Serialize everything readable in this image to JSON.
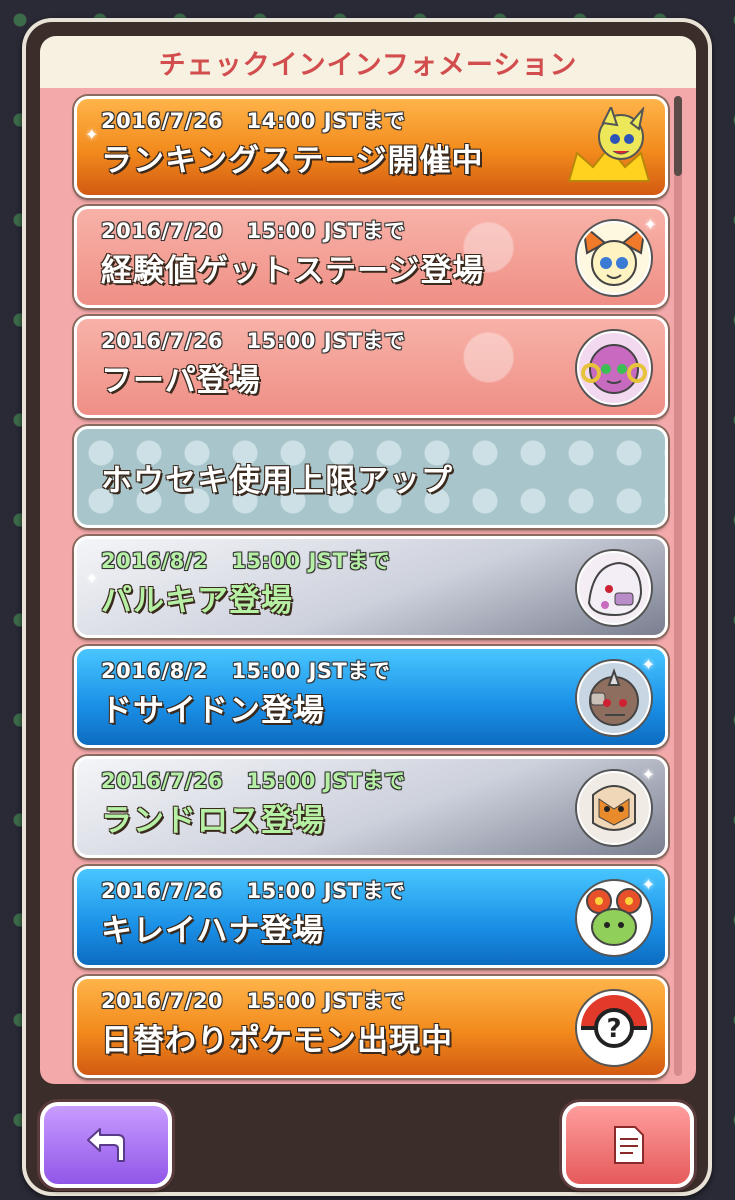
{
  "header": {
    "title": "チェックインインフォメーション"
  },
  "items": [
    {
      "date": "2016/7/26   14:00 JSTまで",
      "name": "ランキングステージ開催中",
      "style": "orange",
      "icon": "meowstic-crown-icon"
    },
    {
      "date": "2016/7/20   15:00 JSTまで",
      "name": "経験値ゲットステージ登場",
      "style": "salmon",
      "icon": "victini-icon"
    },
    {
      "date": "2016/7/26   15:00 JSTまで",
      "name": "フーパ登場",
      "style": "salmon",
      "icon": "hoopa-icon"
    },
    {
      "date": "",
      "name": "ホウセキ使用上限アップ",
      "style": "polka",
      "icon": ""
    },
    {
      "date": "2016/8/2   15:00 JSTまで",
      "name": "パルキア登場",
      "style": "silver",
      "icon": "palkia-icon"
    },
    {
      "date": "2016/8/2   15:00 JSTまで",
      "name": "ドサイドン登場",
      "style": "blue",
      "icon": "rhyperior-icon"
    },
    {
      "date": "2016/7/26   15:00 JSTまで",
      "name": "ランドロス登場",
      "style": "silver",
      "icon": "landorus-icon"
    },
    {
      "date": "2016/7/26   15:00 JSTまで",
      "name": "キレイハナ登場",
      "style": "blue",
      "icon": "bellossom-icon"
    },
    {
      "date": "2016/7/20   15:00 JSTまで",
      "name": "日替わりポケモン出現中",
      "style": "orange",
      "icon": "mystery-pokeball-icon"
    }
  ],
  "footer": {
    "back_icon": "back-arrow-icon",
    "notes_icon": "notes-icon"
  }
}
